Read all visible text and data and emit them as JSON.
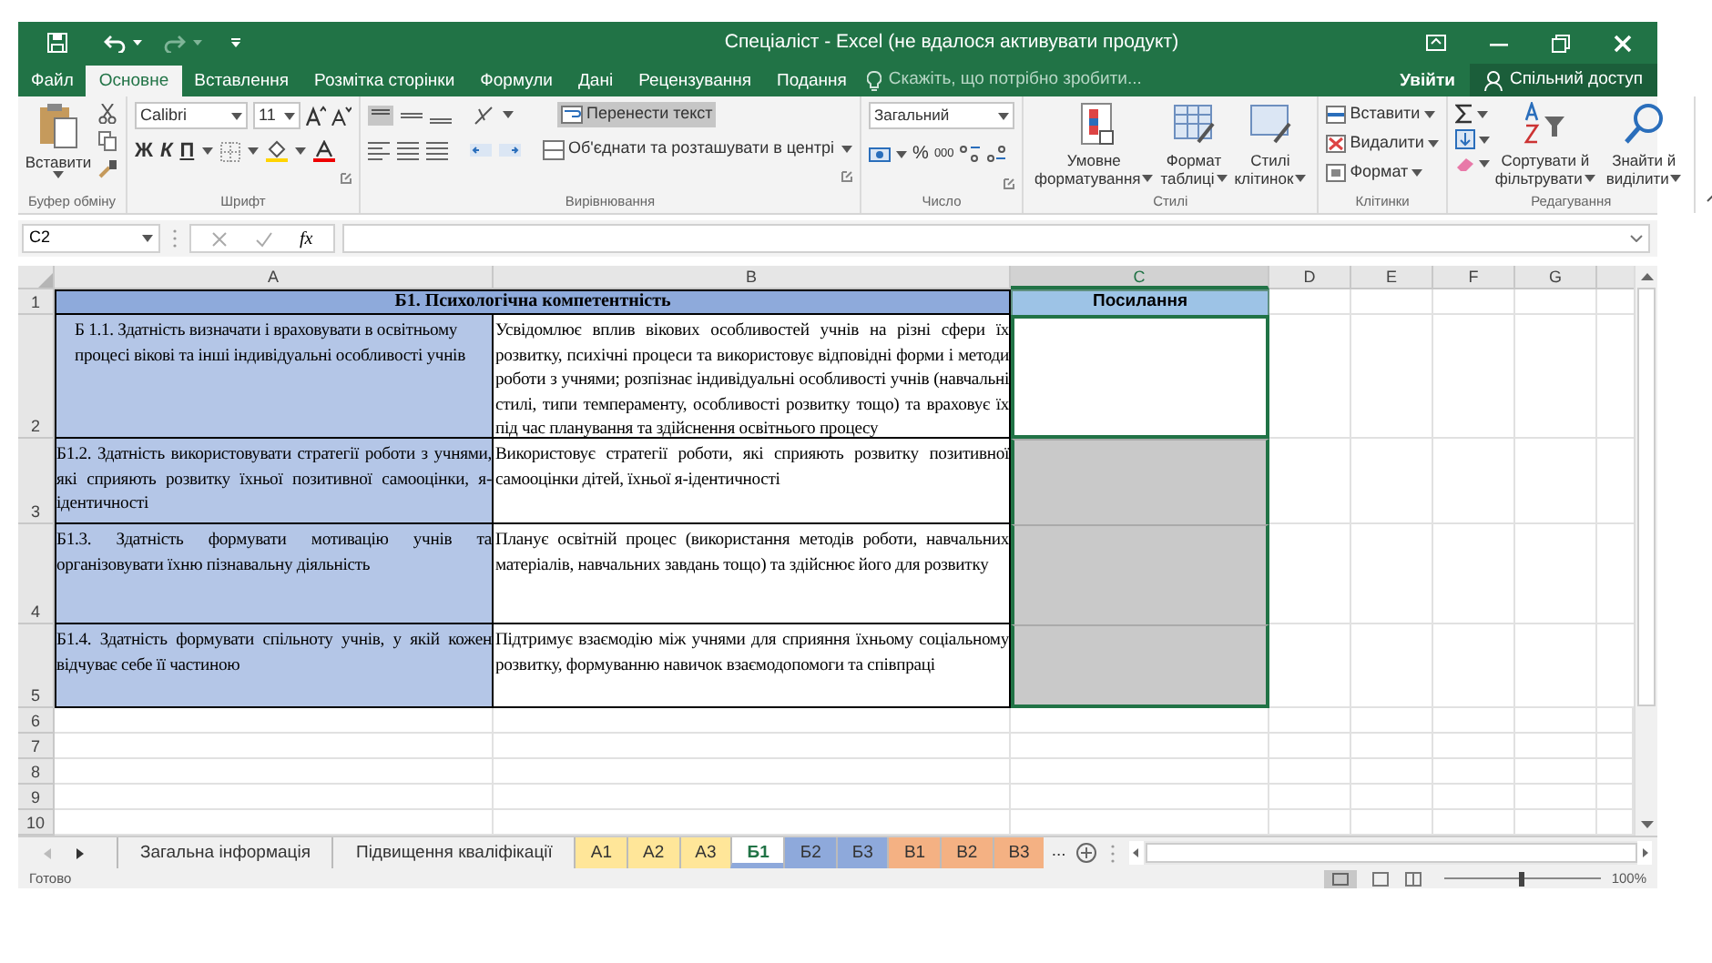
{
  "window": {
    "title": "Спеціаліст - Excel (не вдалося активувати продукт)"
  },
  "menu_tabs": [
    {
      "label": "Файл",
      "selected": false
    },
    {
      "label": "Основне",
      "selected": true
    },
    {
      "label": "Вставлення",
      "selected": false
    },
    {
      "label": "Розмітка сторінки",
      "selected": false
    },
    {
      "label": "Формули",
      "selected": false
    },
    {
      "label": "Дані",
      "selected": false
    },
    {
      "label": "Рецензування",
      "selected": false
    },
    {
      "label": "Подання",
      "selected": false
    }
  ],
  "search": {
    "placeholder": "Скажіть, що потрібно зробити..."
  },
  "sign_in": "Увійти",
  "share": "Спільний доступ",
  "ribbon": {
    "clipboard": {
      "label": "Буфер обміну",
      "paste": "Вставити"
    },
    "font": {
      "label": "Шрифт",
      "font_name": "Calibri",
      "font_size": "11",
      "bold": "Ж",
      "italic": "К",
      "underline": "П"
    },
    "alignment": {
      "label": "Вирівнювання",
      "wrap_text": {
        "label": "Перенести текст",
        "on": true
      },
      "merge": "Об'єднати та розташувати в центрі"
    },
    "number": {
      "label": "Число",
      "format": "Загальний",
      "percent": "%",
      "thousands": "000"
    },
    "styles": {
      "label": "Стилі",
      "buttons": [
        [
          "Умовне",
          "форматування"
        ],
        [
          "Формат",
          "таблиці"
        ],
        [
          "Стилі",
          "клітинок"
        ]
      ]
    },
    "cells": {
      "label": "Клітинки",
      "buttons": [
        "Вставити",
        "Видалити",
        "Формат"
      ]
    },
    "editing": {
      "label": "Редагування",
      "buttons": [
        [
          "Сортувати й",
          "фільтрувати"
        ],
        [
          "Знайти й",
          "виділити"
        ]
      ]
    }
  },
  "formula_bar": {
    "name_box": "C2",
    "fx": "fx"
  },
  "columns": [
    {
      "label": "A",
      "selected": false
    },
    {
      "label": "B",
      "selected": false
    },
    {
      "label": "C",
      "selected": true
    },
    {
      "label": "D",
      "selected": false
    },
    {
      "label": "E",
      "selected": false
    },
    {
      "label": "F",
      "selected": false
    },
    {
      "label": "G",
      "selected": false
    }
  ],
  "rows": [
    {
      "number": "1",
      "kind": "header",
      "title": "Б1. Психологічна компетентність",
      "c": "Посилання"
    },
    {
      "number": "2",
      "kind": "data",
      "a": "Б 1.1. Здатність визначати і враховувати в освітньому процесі вікові та інші індивідуальні особливості учнів",
      "b": "Усвідомлює вплив вікових особливостей учнів на різні сфери їх розвитку, психічні процеси та використовує відповідні форми і методи роботи з учнями; розпізнає індивідуальні особливості учнів (навчальні стилі, типи темпераменту, особливості розвитку тощо) та враховує їх під час планування та здійснення освітнього процесу",
      "c_selected": true,
      "c_active": true
    },
    {
      "number": "3",
      "kind": "data",
      "a": "Б1.2. Здатність використовувати стратегії роботи з учнями, які сприяють розвитку їхньої позитивної самооцінки, я-ідентичності",
      "b": "Використовує стратегії роботи, які сприяють розвитку позитивної самооцінки дітей, їхньої я-ідентичності",
      "c_selected": true,
      "c_active": false
    },
    {
      "number": "4",
      "kind": "data",
      "a": "Б1.3. Здатність формувати мотивацію учнів та організовувати їхню пізнавальну діяльність",
      "b": "Планує освітній процес (використання методів роботи, навчальних матеріалів, навчальних завдань тощо) та здійснює його для розвитку",
      "c_selected": true,
      "c_active": false
    },
    {
      "number": "5",
      "kind": "data",
      "a": "Б1.4. Здатність формувати спільноту учнів, у якій кожен відчуває себе її частиною",
      "b": "Підтримує взаємодію між учнями для сприяння їхньому соціальному розвитку, формуванню навичок взаємодопомоги та співпраці",
      "c_selected": true,
      "c_active": false
    },
    {
      "number": "6",
      "kind": "empty"
    },
    {
      "number": "7",
      "kind": "empty"
    },
    {
      "number": "8",
      "kind": "empty"
    },
    {
      "number": "9",
      "kind": "empty"
    },
    {
      "number": "10",
      "kind": "empty"
    }
  ],
  "sheet_tabs": [
    {
      "label": "Загальна інформація",
      "selected": false
    },
    {
      "label": "Підвищення кваліфікації",
      "selected": false
    },
    {
      "label": "А1",
      "selected": false,
      "color": "#ffe699"
    },
    {
      "label": "А2",
      "selected": false,
      "color": "#ffe699"
    },
    {
      "label": "А3",
      "selected": false,
      "color": "#ffe699"
    },
    {
      "label": "Б1",
      "selected": true,
      "color": "#8ea9db"
    },
    {
      "label": "Б2",
      "selected": false,
      "color": "#8ea9db"
    },
    {
      "label": "Б3",
      "selected": false,
      "color": "#8ea9db"
    },
    {
      "label": "В1",
      "selected": false,
      "color": "#f4b183"
    },
    {
      "label": "В2",
      "selected": false,
      "color": "#f4b183"
    },
    {
      "label": "В3",
      "selected": false,
      "color": "#f4b183"
    }
  ],
  "more_tabs": "...",
  "status_bar": {
    "status": "Готово",
    "zoom": "100%",
    "zoom_slider": {
      "level": 0.5
    }
  }
}
